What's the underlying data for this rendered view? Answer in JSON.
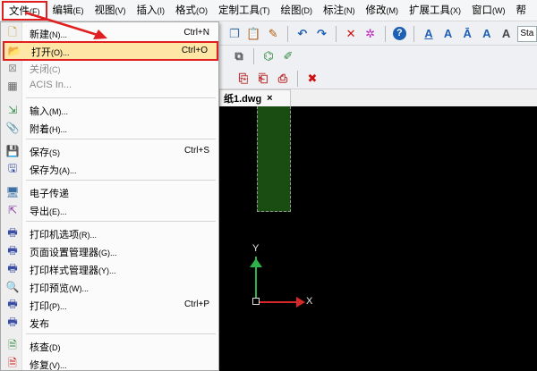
{
  "menubar": {
    "items": [
      {
        "label": "文件",
        "key": "(F)"
      },
      {
        "label": "编辑",
        "key": "(E)"
      },
      {
        "label": "视图",
        "key": "(V)"
      },
      {
        "label": "插入",
        "key": "(I)"
      },
      {
        "label": "格式",
        "key": "(O)"
      },
      {
        "label": "定制工具",
        "key": "(T)"
      },
      {
        "label": "绘图",
        "key": "(D)"
      },
      {
        "label": "标注",
        "key": "(N)"
      },
      {
        "label": "修改",
        "key": "(M)"
      },
      {
        "label": "扩展工具",
        "key": "(X)"
      },
      {
        "label": "窗口",
        "key": "(W)"
      },
      {
        "label": "帮",
        "key": ""
      }
    ]
  },
  "toolbar": {
    "style_value": "Sta"
  },
  "document_tab": {
    "label": "纸1.dwg",
    "close": "×"
  },
  "canvas": {
    "axis_y_label": "Y",
    "axis_x_label": "X"
  },
  "file_menu": {
    "items": [
      {
        "label": "新建",
        "key": "(N)...",
        "shortcut": "Ctrl+N",
        "icon": "new-file-icon"
      },
      {
        "label": "打开",
        "key": "(O)...",
        "shortcut": "Ctrl+O",
        "icon": "open-folder-icon"
      },
      {
        "label": "关闭",
        "key": "(C)",
        "shortcut": "",
        "icon": "close-file-icon"
      },
      {
        "label": "ACIS In...",
        "key": "",
        "shortcut": "",
        "icon": "acis-icon"
      },
      {
        "label": "输入",
        "key": "(M)...",
        "shortcut": "",
        "icon": "import-icon"
      },
      {
        "label": "附着",
        "key": "(H)...",
        "shortcut": "",
        "icon": "attach-icon"
      },
      {
        "label": "保存",
        "key": "(S)",
        "shortcut": "Ctrl+S",
        "icon": "save-icon"
      },
      {
        "label": "保存为",
        "key": "(A)...",
        "shortcut": "",
        "icon": "save-as-icon"
      },
      {
        "label": "电子传递",
        "key": "",
        "shortcut": "",
        "icon": "etransmit-icon"
      },
      {
        "label": "导出",
        "key": "(E)...",
        "shortcut": "",
        "icon": "export-icon"
      },
      {
        "label": "打印机选项",
        "key": "(R)...",
        "shortcut": "",
        "icon": "printer-options-icon"
      },
      {
        "label": "页面设置管理器",
        "key": "(G)...",
        "shortcut": "",
        "icon": "page-setup-icon"
      },
      {
        "label": "打印样式管理器",
        "key": "(Y)...",
        "shortcut": "",
        "icon": "plot-style-icon"
      },
      {
        "label": "打印预览",
        "key": "(W)...",
        "shortcut": "",
        "icon": "print-preview-icon"
      },
      {
        "label": "打印",
        "key": "(P)...",
        "shortcut": "Ctrl+P",
        "icon": "print-icon"
      },
      {
        "label": "发布",
        "key": "",
        "shortcut": "",
        "icon": "publish-icon"
      },
      {
        "label": "核查",
        "key": "(D)",
        "shortcut": "",
        "icon": "audit-icon"
      },
      {
        "label": "修复",
        "key": "(V)...",
        "shortcut": "",
        "icon": "recover-icon"
      }
    ]
  },
  "colors": {
    "highlight": "#fde6a6",
    "annotation_red": "#e02020",
    "shape_green": "#1a4d12"
  }
}
